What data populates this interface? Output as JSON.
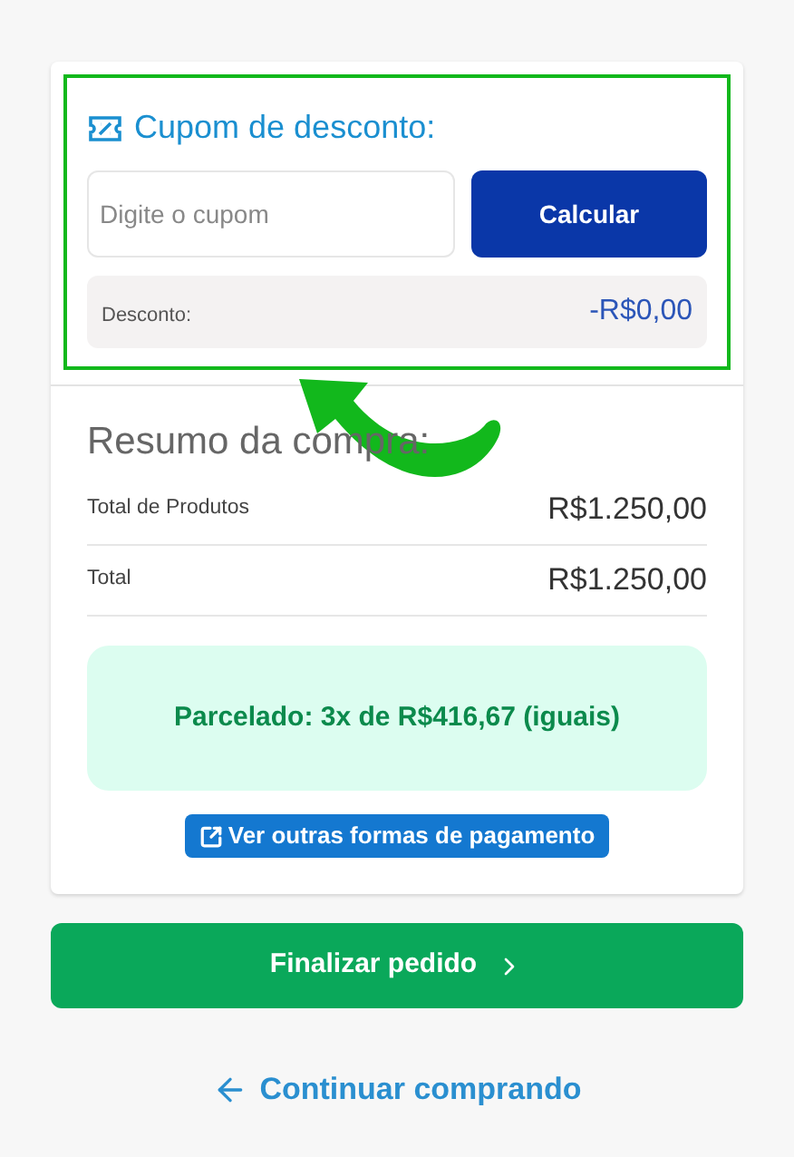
{
  "coupon": {
    "title": "Cupom de desconto:",
    "placeholder": "Digite o cupom",
    "button": "Calcular",
    "discount_label": "Desconto:",
    "discount_value": "-R$0,00"
  },
  "summary": {
    "title": "Resumo da compra:",
    "rows": [
      {
        "label": "Total de Produtos",
        "value": "R$1.250,00"
      },
      {
        "label": "Total",
        "value": "R$1.250,00"
      }
    ],
    "installments": "Parcelado: 3x de R$416,67 (iguais)",
    "payment_link": "Ver outras formas de pagamento"
  },
  "finish_button": "Finalizar pedido",
  "continue_link": "Continuar comprando"
}
